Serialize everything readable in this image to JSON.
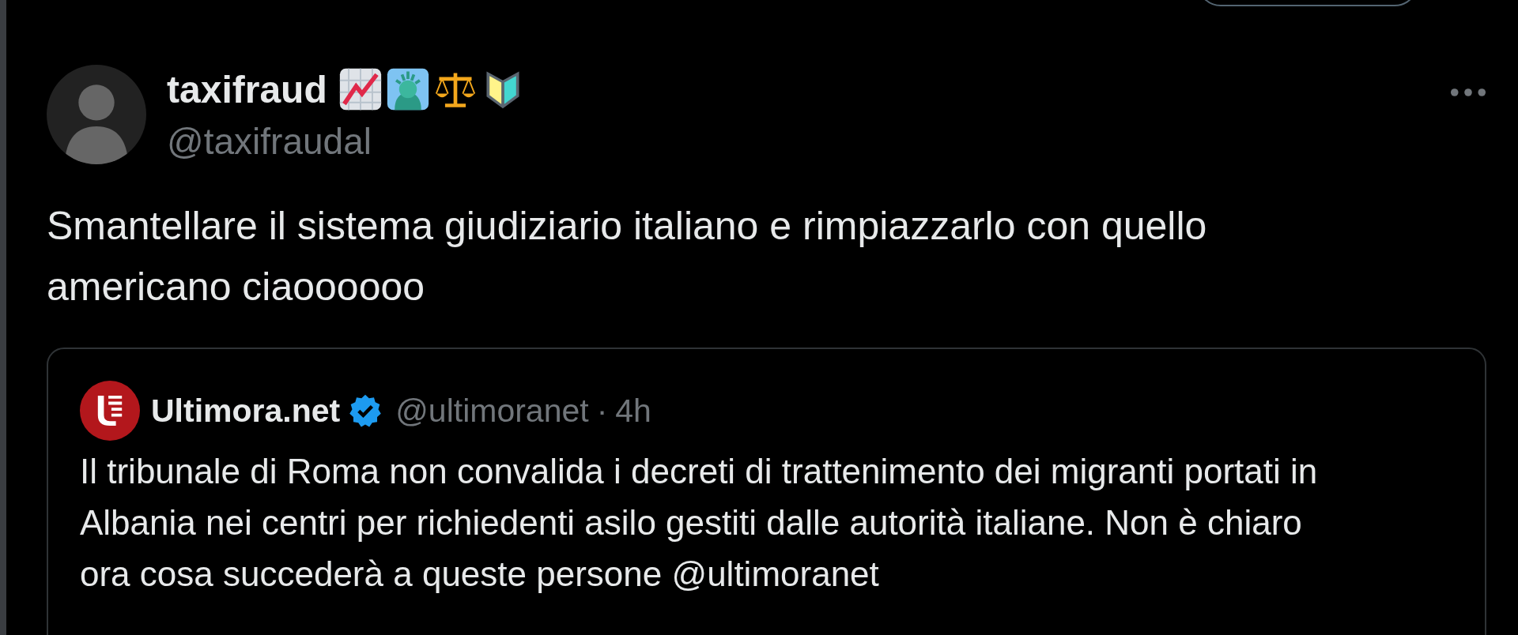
{
  "tweet": {
    "author": {
      "name": "taxifraud",
      "handle": "@taxifraudal"
    },
    "text": "Smantellare il sistema giudiziario italiano e rimpiazzarlo con quello americano ciaoooooo",
    "quote": {
      "author": {
        "name": "Ultimora.net",
        "verified": true,
        "handle": "@ultimoranet",
        "separator": "·",
        "time": "4h"
      },
      "text": "Il tribunale di Roma non convalida i decreti di trattenimento dei migranti portati in Albania nei centri per richiedenti asilo gestiti dalle autorità italiane. Non è chiaro ora cosa succederà a queste persone @ultimoranet"
    }
  }
}
